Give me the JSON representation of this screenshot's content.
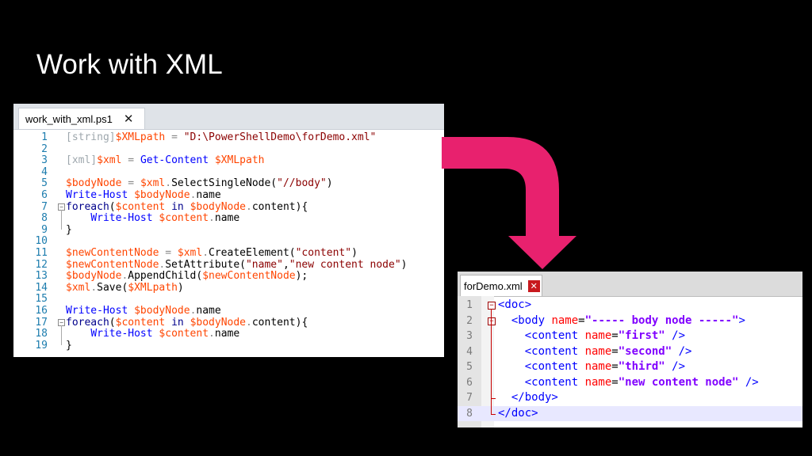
{
  "slide": {
    "title": "Work with XML"
  },
  "ps": {
    "tab_label": "work_with_xml.ps1",
    "tab_close": "✕",
    "lines": [
      {
        "n": "1",
        "fold": "",
        "tokens": [
          [
            "c-type",
            "[string]"
          ],
          [
            "c-var",
            "$XMLpath"
          ],
          [
            "c-op",
            " = "
          ],
          [
            "c-str",
            "\"D:\\PowerShellDemo\\forDemo.xml\""
          ]
        ]
      },
      {
        "n": "2",
        "fold": "",
        "tokens": []
      },
      {
        "n": "3",
        "fold": "",
        "tokens": [
          [
            "c-type",
            "[xml]"
          ],
          [
            "c-var",
            "$xml"
          ],
          [
            "c-op",
            " = "
          ],
          [
            "c-cmd",
            "Get-Content"
          ],
          [
            "c-txt",
            " "
          ],
          [
            "c-var",
            "$XMLpath"
          ]
        ]
      },
      {
        "n": "4",
        "fold": "",
        "tokens": []
      },
      {
        "n": "5",
        "fold": "",
        "tokens": [
          [
            "c-var",
            "$bodyNode"
          ],
          [
            "c-op",
            " = "
          ],
          [
            "c-var",
            "$xml"
          ],
          [
            "c-op",
            "."
          ],
          [
            "c-txt",
            "SelectSingleNode("
          ],
          [
            "c-str",
            "\"//body\""
          ],
          [
            "c-txt",
            ")"
          ]
        ]
      },
      {
        "n": "6",
        "fold": "",
        "tokens": [
          [
            "c-cmd",
            "Write-Host"
          ],
          [
            "c-txt",
            " "
          ],
          [
            "c-var",
            "$bodyNode"
          ],
          [
            "c-op",
            "."
          ],
          [
            "c-txt",
            "name"
          ]
        ]
      },
      {
        "n": "7",
        "fold": "−",
        "tokens": [
          [
            "c-kw",
            "foreach"
          ],
          [
            "c-txt",
            "("
          ],
          [
            "c-var",
            "$content"
          ],
          [
            "c-txt",
            " "
          ],
          [
            "c-kw",
            "in"
          ],
          [
            "c-txt",
            " "
          ],
          [
            "c-var",
            "$bodyNode"
          ],
          [
            "c-op",
            "."
          ],
          [
            "c-txt",
            "content){"
          ]
        ]
      },
      {
        "n": "8",
        "fold": "",
        "tokens": [
          [
            "c-txt",
            "    "
          ],
          [
            "c-cmd",
            "Write-Host"
          ],
          [
            "c-txt",
            " "
          ],
          [
            "c-var",
            "$content"
          ],
          [
            "c-op",
            "."
          ],
          [
            "c-txt",
            "name"
          ]
        ]
      },
      {
        "n": "9",
        "fold": "",
        "tokens": [
          [
            "c-txt",
            "}"
          ]
        ]
      },
      {
        "n": "10",
        "fold": "",
        "tokens": []
      },
      {
        "n": "11",
        "fold": "",
        "tokens": [
          [
            "c-var",
            "$newContentNode"
          ],
          [
            "c-op",
            " = "
          ],
          [
            "c-var",
            "$xml"
          ],
          [
            "c-op",
            "."
          ],
          [
            "c-txt",
            "CreateElement("
          ],
          [
            "c-str",
            "\"content\""
          ],
          [
            "c-txt",
            ")"
          ]
        ]
      },
      {
        "n": "12",
        "fold": "",
        "tokens": [
          [
            "c-var",
            "$newContentNode"
          ],
          [
            "c-op",
            "."
          ],
          [
            "c-txt",
            "SetAttribute("
          ],
          [
            "c-str",
            "\"name\""
          ],
          [
            "c-txt",
            ","
          ],
          [
            "c-str",
            "\"new content node\""
          ],
          [
            "c-txt",
            ")"
          ]
        ]
      },
      {
        "n": "13",
        "fold": "",
        "tokens": [
          [
            "c-var",
            "$bodyNode"
          ],
          [
            "c-op",
            "."
          ],
          [
            "c-txt",
            "AppendChild("
          ],
          [
            "c-var",
            "$newContentNode"
          ],
          [
            "c-txt",
            ");"
          ]
        ]
      },
      {
        "n": "14",
        "fold": "",
        "tokens": [
          [
            "c-var",
            "$xml"
          ],
          [
            "c-op",
            "."
          ],
          [
            "c-txt",
            "Save("
          ],
          [
            "c-var",
            "$XMLpath"
          ],
          [
            "c-txt",
            ")"
          ]
        ]
      },
      {
        "n": "15",
        "fold": "",
        "tokens": []
      },
      {
        "n": "16",
        "fold": "",
        "tokens": [
          [
            "c-cmd",
            "Write-Host"
          ],
          [
            "c-txt",
            " "
          ],
          [
            "c-var",
            "$bodyNode"
          ],
          [
            "c-op",
            "."
          ],
          [
            "c-txt",
            "name"
          ]
        ]
      },
      {
        "n": "17",
        "fold": "−",
        "tokens": [
          [
            "c-kw",
            "foreach"
          ],
          [
            "c-txt",
            "("
          ],
          [
            "c-var",
            "$content"
          ],
          [
            "c-txt",
            " "
          ],
          [
            "c-kw",
            "in"
          ],
          [
            "c-txt",
            " "
          ],
          [
            "c-var",
            "$bodyNode"
          ],
          [
            "c-op",
            "."
          ],
          [
            "c-txt",
            "content){"
          ]
        ]
      },
      {
        "n": "18",
        "fold": "",
        "tokens": [
          [
            "c-txt",
            "    "
          ],
          [
            "c-cmd",
            "Write-Host"
          ],
          [
            "c-txt",
            " "
          ],
          [
            "c-var",
            "$content"
          ],
          [
            "c-op",
            "."
          ],
          [
            "c-txt",
            "name"
          ]
        ]
      },
      {
        "n": "19",
        "fold": "",
        "tokens": [
          [
            "c-txt",
            "}"
          ]
        ]
      }
    ]
  },
  "npp": {
    "tab_label": "forDemo.xml",
    "tab_close": "✕",
    "current_line": 8,
    "lines": [
      {
        "n": "1",
        "fold": "−",
        "tokens": [
          [
            "x-tag",
            "<doc>"
          ]
        ]
      },
      {
        "n": "2",
        "fold": "−",
        "tokens": [
          [
            "x-tag",
            "  <body "
          ],
          [
            "x-attr",
            "name"
          ],
          [
            "x-eq",
            "="
          ],
          [
            "x-val",
            "\"----- body node -----\""
          ],
          [
            "x-tag",
            ">"
          ]
        ]
      },
      {
        "n": "3",
        "fold": "",
        "tokens": [
          [
            "x-tag",
            "    <content "
          ],
          [
            "x-attr",
            "name"
          ],
          [
            "x-eq",
            "="
          ],
          [
            "x-val",
            "\"first\""
          ],
          [
            "x-tag",
            " />"
          ]
        ]
      },
      {
        "n": "4",
        "fold": "",
        "tokens": [
          [
            "x-tag",
            "    <content "
          ],
          [
            "x-attr",
            "name"
          ],
          [
            "x-eq",
            "="
          ],
          [
            "x-val",
            "\"second\""
          ],
          [
            "x-tag",
            " />"
          ]
        ]
      },
      {
        "n": "5",
        "fold": "",
        "tokens": [
          [
            "x-tag",
            "    <content "
          ],
          [
            "x-attr",
            "name"
          ],
          [
            "x-eq",
            "="
          ],
          [
            "x-val",
            "\"third\""
          ],
          [
            "x-tag",
            " />"
          ]
        ]
      },
      {
        "n": "6",
        "fold": "",
        "tokens": [
          [
            "x-tag",
            "    <content "
          ],
          [
            "x-attr",
            "name"
          ],
          [
            "x-eq",
            "="
          ],
          [
            "x-val",
            "\"new content node\""
          ],
          [
            "x-tag",
            " />"
          ]
        ]
      },
      {
        "n": "7",
        "fold": "",
        "tokens": [
          [
            "x-tag",
            "  </body>"
          ]
        ]
      },
      {
        "n": "8",
        "fold": "",
        "tokens": [
          [
            "x-tag",
            "</doc>"
          ]
        ]
      }
    ]
  },
  "colors": {
    "arrow": "#e8216e",
    "background": "#000000"
  }
}
